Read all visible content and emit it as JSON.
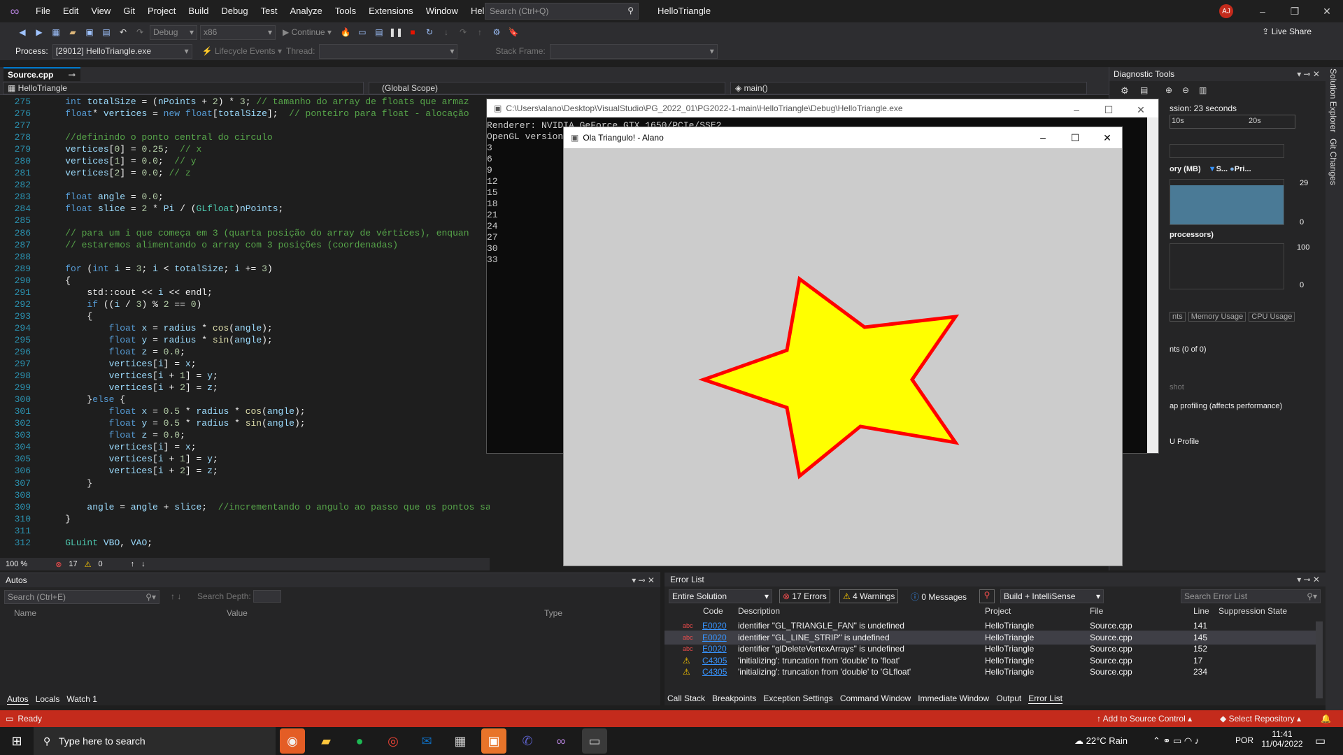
{
  "menu": {
    "items": [
      "File",
      "Edit",
      "View",
      "Git",
      "Project",
      "Build",
      "Debug",
      "Test",
      "Analyze",
      "Tools",
      "Extensions",
      "Window",
      "Help"
    ],
    "search_placeholder": "Search (Ctrl+Q)",
    "solution_name": "HelloTriangle",
    "avatar_initials": "AJ"
  },
  "toolbar": {
    "config": "Debug",
    "platform": "x86",
    "continue": "Continue",
    "live_share": "Live Share"
  },
  "debugbar": {
    "process_label": "Process:",
    "process_value": "[29012] HelloTriangle.exe",
    "lifecycle": "Lifecycle Events",
    "thread_label": "Thread:",
    "stack_label": "Stack Frame:"
  },
  "editor": {
    "tab": "Source.cpp",
    "nav_project": "HelloTriangle",
    "nav_scope": "(Global Scope)",
    "nav_member": "main()",
    "zoom": "100 %",
    "errors": "17",
    "warnings": "0"
  },
  "code_lines": [
    {
      "n": "275",
      "t": "    int totalSize = (nPoints + 2) * 3; // tamanho do array de floats que armaz"
    },
    {
      "n": "276",
      "t": "    float* vertices = new float[totalSize];  // ponteiro para float - alocação"
    },
    {
      "n": "277",
      "t": ""
    },
    {
      "n": "278",
      "t": "    //definindo o ponto central do circulo"
    },
    {
      "n": "279",
      "t": "    vertices[0] = 0.25;  // x"
    },
    {
      "n": "280",
      "t": "    vertices[1] = 0.0;  // y"
    },
    {
      "n": "281",
      "t": "    vertices[2] = 0.0; // z"
    },
    {
      "n": "282",
      "t": ""
    },
    {
      "n": "283",
      "t": "    float angle = 0.0;"
    },
    {
      "n": "284",
      "t": "    float slice = 2 * Pi / (GLfloat)nPoints;"
    },
    {
      "n": "285",
      "t": ""
    },
    {
      "n": "286",
      "t": "    // para um i que começa em 3 (quarta posição do array de vértices), enquan"
    },
    {
      "n": "287",
      "t": "    // estaremos alimentando o array com 3 posições (coordenadas)"
    },
    {
      "n": "288",
      "t": ""
    },
    {
      "n": "289",
      "t": "    for (int i = 3; i < totalSize; i += 3)"
    },
    {
      "n": "290",
      "t": "    {"
    },
    {
      "n": "291",
      "t": "        std::cout << i << endl;"
    },
    {
      "n": "292",
      "t": "        if ((i / 3) % 2 == 0)"
    },
    {
      "n": "293",
      "t": "        {"
    },
    {
      "n": "294",
      "t": "            float x = radius * cos(angle);"
    },
    {
      "n": "295",
      "t": "            float y = radius * sin(angle);"
    },
    {
      "n": "296",
      "t": "            float z = 0.0;"
    },
    {
      "n": "297",
      "t": "            vertices[i] = x;"
    },
    {
      "n": "298",
      "t": "            vertices[i + 1] = y;"
    },
    {
      "n": "299",
      "t": "            vertices[i + 2] = z;"
    },
    {
      "n": "300",
      "t": "        }else {"
    },
    {
      "n": "301",
      "t": "            float x = 0.5 * radius * cos(angle);"
    },
    {
      "n": "302",
      "t": "            float y = 0.5 * radius * sin(angle);"
    },
    {
      "n": "303",
      "t": "            float z = 0.0;"
    },
    {
      "n": "304",
      "t": "            vertices[i] = x;"
    },
    {
      "n": "305",
      "t": "            vertices[i + 1] = y;"
    },
    {
      "n": "306",
      "t": "            vertices[i + 2] = z;"
    },
    {
      "n": "307",
      "t": "        }"
    },
    {
      "n": "308",
      "t": ""
    },
    {
      "n": "309",
      "t": "        angle = angle + slice;  //incrementando o angulo ao passo que os pontos sao adiciona"
    },
    {
      "n": "310",
      "t": "    }"
    },
    {
      "n": "311",
      "t": ""
    },
    {
      "n": "312",
      "t": "    GLuint VBO, VAO;"
    }
  ],
  "console": {
    "title": "C:\\Users\\alano\\Desktop\\VisualStudio\\PG_2022_01\\PG2022-1-main\\HelloTriangle\\Debug\\HelloTriangle.exe",
    "lines": [
      "Renderer: NVIDIA GeForce GTX 1650/PCIe/SSE2",
      "OpenGL version",
      "3",
      "6",
      "9",
      "12",
      "15",
      "18",
      "21",
      "24",
      "27",
      "30",
      "33"
    ]
  },
  "glwindow": {
    "title": "Ola Triangulo! - Alano",
    "star_fill": "#ffff00",
    "star_stroke": "#ff0000",
    "background": "#cccccc"
  },
  "diagnostics": {
    "title": "Diagnostic Tools",
    "session": "ssion: 23 seconds",
    "t1": "10s",
    "t2": "20s",
    "memory": "ory (MB)",
    "legend_s": "S...",
    "legend_p": "Pri...",
    "mem_max": "29",
    "mem_min": "0",
    "cpu": "processors)",
    "cpu_max": "100",
    "cpu_min": "0",
    "tabs": [
      "nts",
      "Memory Usage",
      "CPU Usage"
    ],
    "events": "nts (0 of 0)",
    "snapshot": "shot",
    "heap": "ap profiling (affects performance)",
    "profile": "U Profile"
  },
  "side_labels": [
    "Solution Explorer",
    "Git Changes"
  ],
  "autos": {
    "title": "Autos",
    "search": "Search (Ctrl+E)",
    "depth": "Search Depth:",
    "cols": [
      "Name",
      "Value",
      "Type"
    ],
    "tabs": [
      "Autos",
      "Locals",
      "Watch 1"
    ]
  },
  "errorlist": {
    "title": "Error List",
    "scope": "Entire Solution",
    "errors": "17 Errors",
    "warnings": "4 Warnings",
    "messages": "0 Messages",
    "build": "Build + IntelliSense",
    "search": "Search Error List",
    "cols": [
      "Code",
      "Description",
      "Project",
      "File",
      "Line",
      "Suppression State"
    ],
    "rows": [
      {
        "icon": "abc",
        "code": "E0020",
        "desc": "identifier \"GL_TRIANGLE_FAN\" is undefined",
        "project": "HelloTriangle",
        "file": "Source.cpp",
        "line": "141"
      },
      {
        "icon": "abc",
        "code": "E0020",
        "desc": "identifier \"GL_LINE_STRIP\" is undefined",
        "project": "HelloTriangle",
        "file": "Source.cpp",
        "line": "145"
      },
      {
        "icon": "abc",
        "code": "E0020",
        "desc": "identifier \"glDeleteVertexArrays\" is undefined",
        "project": "HelloTriangle",
        "file": "Source.cpp",
        "line": "152"
      },
      {
        "icon": "warn",
        "code": "C4305",
        "desc": "'initializing': truncation from 'double' to 'float'",
        "project": "HelloTriangle",
        "file": "Source.cpp",
        "line": "17"
      },
      {
        "icon": "warn",
        "code": "C4305",
        "desc": "'initializing': truncation from 'double' to 'GLfloat'",
        "project": "HelloTriangle",
        "file": "Source.cpp",
        "line": "234"
      }
    ],
    "tabs": [
      "Call Stack",
      "Breakpoints",
      "Exception Settings",
      "Command Window",
      "Immediate Window",
      "Output",
      "Error List"
    ]
  },
  "status": {
    "ready": "Ready",
    "source_control": "Add to Source Control",
    "repo": "Select Repository"
  },
  "taskbar": {
    "search": "Type here to search",
    "weather": "22°C  Rain",
    "lang": "POR",
    "time": "11:41",
    "date": "11/04/2022"
  }
}
